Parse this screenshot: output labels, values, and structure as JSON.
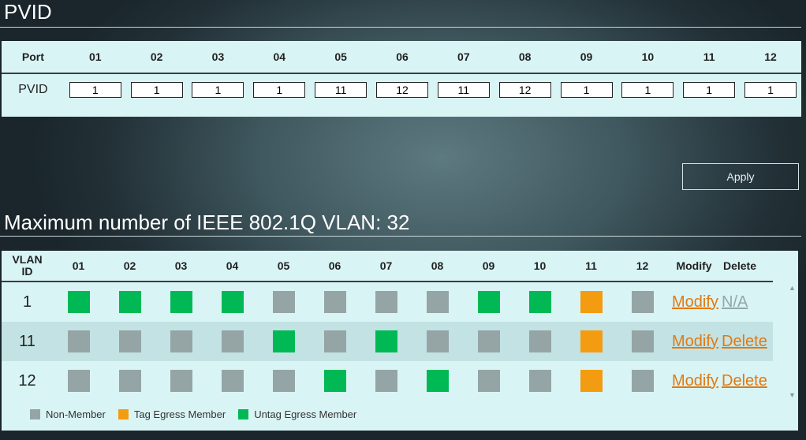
{
  "colors": {
    "non_member": "#95a5a6",
    "tag_egress": "#f39c12",
    "untag_egress": "#00b955"
  },
  "pvid": {
    "title": "PVID",
    "port_label": "Port",
    "pvid_label": "PVID",
    "ports": [
      "01",
      "02",
      "03",
      "04",
      "05",
      "06",
      "07",
      "08",
      "09",
      "10",
      "11",
      "12"
    ],
    "values": [
      "1",
      "1",
      "1",
      "1",
      "11",
      "12",
      "11",
      "12",
      "1",
      "1",
      "1",
      "1"
    ]
  },
  "apply_label": "Apply",
  "vlan": {
    "title": "Maximum number of IEEE 802.1Q VLAN: 32",
    "header": {
      "id_line1": "VLAN",
      "id_line2": "ID",
      "ports": [
        "01",
        "02",
        "03",
        "04",
        "05",
        "06",
        "07",
        "08",
        "09",
        "10",
        "11",
        "12"
      ],
      "modify": "Modify",
      "delete": "Delete"
    },
    "rows": [
      {
        "id": "1",
        "members": [
          "U",
          "U",
          "U",
          "U",
          "N",
          "N",
          "N",
          "N",
          "U",
          "U",
          "T",
          "N"
        ],
        "modify": "Modify",
        "delete": "N/A"
      },
      {
        "id": "11",
        "members": [
          "N",
          "N",
          "N",
          "N",
          "U",
          "N",
          "U",
          "N",
          "N",
          "N",
          "T",
          "N"
        ],
        "modify": "Modify",
        "delete": "Delete"
      },
      {
        "id": "12",
        "members": [
          "N",
          "N",
          "N",
          "N",
          "N",
          "U",
          "N",
          "U",
          "N",
          "N",
          "T",
          "N"
        ],
        "modify": "Modify",
        "delete": "Delete"
      }
    ],
    "legend": {
      "non_member": "Non-Member",
      "tag_egress": "Tag Egress Member",
      "untag_egress": "Untag Egress Member"
    }
  }
}
